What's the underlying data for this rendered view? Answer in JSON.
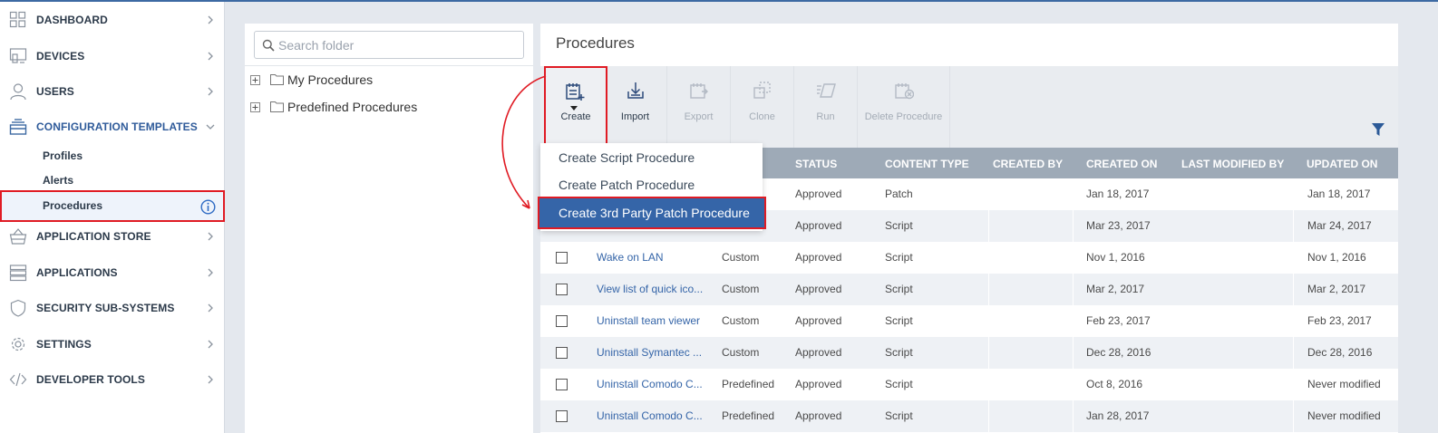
{
  "sidebar": {
    "items": [
      {
        "label": "DASHBOARD",
        "icon": "dashboard-grid-icon"
      },
      {
        "label": "DEVICES",
        "icon": "devices-icon"
      },
      {
        "label": "USERS",
        "icon": "user-icon"
      },
      {
        "label": "CONFIGURATION TEMPLATES",
        "icon": "templates-icon",
        "expanded": true
      },
      {
        "label": "APPLICATION STORE",
        "icon": "basket-icon"
      },
      {
        "label": "APPLICATIONS",
        "icon": "applications-icon"
      },
      {
        "label": "SECURITY SUB-SYSTEMS",
        "icon": "shield-icon"
      },
      {
        "label": "SETTINGS",
        "icon": "gear-icon"
      },
      {
        "label": "DEVELOPER TOOLS",
        "icon": "code-icon"
      }
    ],
    "subitems": [
      {
        "label": "Profiles"
      },
      {
        "label": "Alerts"
      },
      {
        "label": "Procedures",
        "selected": true
      }
    ]
  },
  "folders": {
    "search_placeholder": "Search folder",
    "tree": [
      {
        "label": "My Procedures"
      },
      {
        "label": "Predefined Procedures"
      }
    ]
  },
  "procedures": {
    "title": "Procedures",
    "toolbar": [
      {
        "label": "Create",
        "enabled": true
      },
      {
        "label": "Import",
        "enabled": true
      },
      {
        "label": "Export",
        "enabled": false
      },
      {
        "label": "Clone",
        "enabled": false
      },
      {
        "label": "Run",
        "enabled": false
      },
      {
        "label": "Delete Procedure",
        "enabled": false
      }
    ],
    "dropdown": [
      {
        "label": "Create Script Procedure"
      },
      {
        "label": "Create Patch Procedure"
      },
      {
        "label": "Create 3rd Party Patch Procedure",
        "highlighted": true
      }
    ],
    "columns": {
      "status": "STATUS",
      "content_type": "CONTENT TYPE",
      "created_by": "CREATED BY",
      "created_on": "CREATED ON",
      "last_modified_by": "LAST MODIFIED BY",
      "updated_on": "UPDATED ON"
    },
    "rows": [
      {
        "name": "",
        "type": "",
        "status": "Approved",
        "content_type": "Patch",
        "created_on": "Jan 18, 2017",
        "updated_on": "Jan 18, 2017"
      },
      {
        "name": "",
        "type": "",
        "status": "Approved",
        "content_type": "Script",
        "created_on": "Mar 23, 2017",
        "updated_on": "Mar 24, 2017"
      },
      {
        "name": "Wake on LAN",
        "type": "Custom",
        "status": "Approved",
        "content_type": "Script",
        "created_on": "Nov 1, 2016",
        "updated_on": "Nov 1, 2016"
      },
      {
        "name": "View list of quick ico...",
        "type": "Custom",
        "status": "Approved",
        "content_type": "Script",
        "created_on": "Mar 2, 2017",
        "updated_on": "Mar 2, 2017"
      },
      {
        "name": "Uninstall team viewer",
        "type": "Custom",
        "status": "Approved",
        "content_type": "Script",
        "created_on": "Feb 23, 2017",
        "updated_on": "Feb 23, 2017"
      },
      {
        "name": "Uninstall Symantec ...",
        "type": "Custom",
        "status": "Approved",
        "content_type": "Script",
        "created_on": "Dec 28, 2016",
        "updated_on": "Dec 28, 2016"
      },
      {
        "name": "Uninstall Comodo C...",
        "type": "Predefined",
        "status": "Approved",
        "content_type": "Script",
        "created_on": "Oct 8, 2016",
        "updated_on": "Never modified"
      },
      {
        "name": "Uninstall Comodo C...",
        "type": "Predefined",
        "status": "Approved",
        "content_type": "Script",
        "created_on": "Jan 28, 2017",
        "updated_on": "Never modified"
      }
    ]
  },
  "colors": {
    "accent": "#3565a8",
    "highlight_border": "#e01b24",
    "header_bg": "#9eaab7"
  }
}
